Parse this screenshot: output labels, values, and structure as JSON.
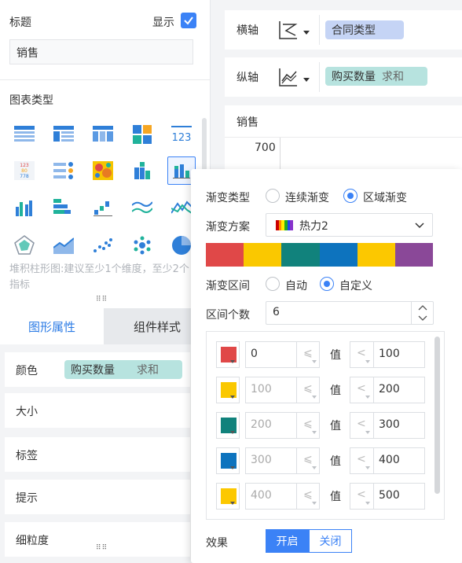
{
  "header": {
    "title_label": "标题",
    "show_label": "显示",
    "show_checked": true,
    "title_value": "销售"
  },
  "chart_types": {
    "section_title": "图表类型",
    "icons": [
      "table-icon",
      "cross-table-icon",
      "grouped-table-icon",
      "color-blocks-icon",
      "kpi-number-icon",
      "multi-kpi-icon",
      "bullet-list-icon",
      "heatmap-icon",
      "stacked-column-icon",
      "stacked-bar-icon",
      "grouped-bar-icon",
      "horizontal-bar-icon",
      "waterfall-icon",
      "multi-line-icon",
      "line-chart-icon",
      "radar-icon",
      "area-chart-icon",
      "scatter-icon",
      "dot-cluster-icon",
      "pie-chart-icon"
    ],
    "selected": "stacked-bar-icon",
    "hint": "堆积柱形图:建议至少1个维度，至少2个指标"
  },
  "tabs": {
    "graphic_props": "图形属性",
    "component_style": "组件样式"
  },
  "props": {
    "color": "颜色",
    "color_field": "购买数量",
    "color_agg": "求和",
    "size": "大小",
    "label": "标签",
    "tooltip": "提示",
    "granularity": "细粒度"
  },
  "axes": {
    "x_label": "横轴",
    "x_field": "合同类型",
    "y_label": "纵轴",
    "y_field": "购买数量",
    "y_agg": "求和"
  },
  "chart": {
    "title": "销售",
    "y_tick": "700"
  },
  "gradient": {
    "type_label": "渐变类型",
    "opt_continuous": "连续渐变",
    "opt_region": "区域渐变",
    "selected_type": "区域渐变",
    "scheme_label": "渐变方案",
    "scheme_value": "热力2",
    "rainbow": [
      "#cc0000",
      "#ff8800",
      "#ffee00",
      "#22aa22",
      "#2244ee",
      "#8833cc"
    ],
    "swatch_colors": [
      "#e04848",
      "#fac800",
      "#11827c",
      "#0d73be",
      "#fcc800",
      "#8a4898"
    ],
    "interval_label": "渐变区间",
    "opt_auto": "自动",
    "opt_custom": "自定义",
    "selected_interval": "自定义",
    "count_label": "区间个数",
    "count_value": "6",
    "value_label": "值",
    "ranges": [
      {
        "color": "#e04848",
        "from": "0",
        "to": "100"
      },
      {
        "color": "#fac800",
        "from": "100",
        "to": "200"
      },
      {
        "color": "#11827c",
        "from": "200",
        "to": "300"
      },
      {
        "color": "#0d73be",
        "from": "300",
        "to": "400"
      },
      {
        "color": "#fcc800",
        "from": "400",
        "to": "500"
      }
    ],
    "effect_label": "效果",
    "effect_on": "开启",
    "effect_off": "关闭"
  }
}
